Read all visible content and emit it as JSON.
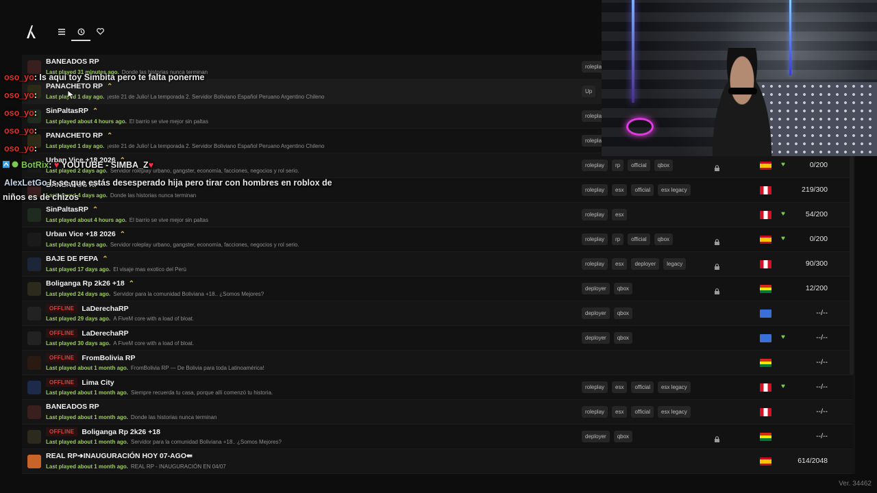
{
  "version": "Ver. 34462",
  "colors": {
    "accent_green": "#9fcf5a",
    "offline_red": "#e0403a",
    "boost_gold": "#e6c04a",
    "fav_green": "#7ec850"
  },
  "nav": {
    "icons": [
      "menu-icon",
      "history-icon",
      "heart-icon"
    ],
    "active": "history"
  },
  "servers": [
    {
      "name": "BANEADOS RP",
      "boost": false,
      "offline": false,
      "last_played": "Last played 31 minutes ago.",
      "desc": "Donde las historias nunca terminan",
      "tags": [
        "roleplay"
      ],
      "locked": false,
      "flag": "",
      "fav": false,
      "players": ""
    },
    {
      "name": "PANACHETO RP",
      "boost": true,
      "offline": false,
      "last_played": "Last played 1 day ago.",
      "desc": "¡este 21 de Julio! La temporada 2. Servidor Boliviano Español Peruano Argentino Chileno",
      "tags": [
        "Up"
      ],
      "locked": false,
      "flag": "",
      "fav": false,
      "players": ""
    },
    {
      "name": "SinPaltasRP",
      "boost": true,
      "offline": false,
      "last_played": "Last played about 4 hours ago.",
      "desc": "El barrio se vive mejor sin paltas",
      "tags": [
        "roleplay"
      ],
      "locked": false,
      "flag": "",
      "fav": false,
      "players": ""
    },
    {
      "name": "PANACHETO RP",
      "boost": true,
      "offline": false,
      "last_played": "Last played 1 day ago.",
      "desc": "¡este 21 de Julio! La temporada 2. Servidor Boliviano Español Peruano Argentino Chileno",
      "tags": [
        "roleplay"
      ],
      "locked": false,
      "flag": "",
      "fav": false,
      "players": ""
    },
    {
      "name": "Urban Vice +18 2026",
      "boost": true,
      "offline": false,
      "last_played": "Last played 2 days ago.",
      "desc": "Servidor roleplay urbano, gangster, economía, facciones, negocios y rol serio.",
      "tags": [
        "roleplay",
        "rp",
        "official",
        "qbox"
      ],
      "locked": true,
      "flag": "es",
      "fav": true,
      "players": "0/200"
    },
    {
      "name": "BANEADOS RP",
      "boost": false,
      "offline": false,
      "last_played": "Last played 4 days ago.",
      "desc": "Donde las historias nunca terminan",
      "tags": [
        "roleplay",
        "esx",
        "official",
        "esx legacy"
      ],
      "locked": false,
      "flag": "pe",
      "fav": false,
      "players": "219/300"
    },
    {
      "name": "SinPaltasRP",
      "boost": true,
      "offline": false,
      "last_played": "Last played about 4 hours ago.",
      "desc": "El barrio se vive mejor sin paltas",
      "tags": [
        "roleplay",
        "esx"
      ],
      "locked": false,
      "flag": "pe",
      "fav": true,
      "players": "54/200"
    },
    {
      "name": "Urban Vice +18 2026",
      "boost": true,
      "offline": false,
      "last_played": "Last played 2 days ago.",
      "desc": "Servidor roleplay urbano, gangster, economía, facciones, negocios y rol serio.",
      "tags": [
        "roleplay",
        "rp",
        "official",
        "qbox"
      ],
      "locked": true,
      "flag": "es",
      "fav": true,
      "players": "0/200"
    },
    {
      "name": "BAJE DE PEPA",
      "boost": true,
      "offline": false,
      "last_played": "Last played 17 days ago.",
      "desc": "El visaje mas exotico del Perú",
      "tags": [
        "roleplay",
        "esx",
        "deployer",
        "legacy"
      ],
      "locked": true,
      "flag": "pe",
      "fav": false,
      "players": "90/300"
    },
    {
      "name": "Boliganga Rp 2k26 +18",
      "boost": true,
      "offline": false,
      "last_played": "Last played 24 days ago.",
      "desc": "Servidor para la comunidad Boliviana +18.. ¿Somos Mejores?",
      "tags": [
        "deployer",
        "qbox"
      ],
      "locked": true,
      "flag": "bo",
      "fav": false,
      "players": "12/200"
    },
    {
      "name": "LaDerechaRP",
      "boost": false,
      "offline": true,
      "last_played": "Last played 29 days ago.",
      "desc": "A FiveM core with a load of bloat.",
      "tags": [
        "deployer",
        "qbox"
      ],
      "locked": false,
      "flag": "un",
      "fav": false,
      "players": "--/--"
    },
    {
      "name": "LaDerechaRP",
      "boost": false,
      "offline": true,
      "last_played": "Last played 30 days ago.",
      "desc": "A FiveM core with a load of bloat.",
      "tags": [
        "deployer",
        "qbox"
      ],
      "locked": false,
      "flag": "un",
      "fav": true,
      "players": "--/--"
    },
    {
      "name": "FromBolivia RP",
      "boost": false,
      "offline": true,
      "last_played": "Last played about 1 month ago.",
      "desc": "FromBolivia RP — De Bolivia para toda Latinoamérica!",
      "tags": [],
      "locked": false,
      "flag": "bo",
      "fav": false,
      "players": "--/--"
    },
    {
      "name": "Lima City",
      "boost": false,
      "offline": true,
      "last_played": "Last played about 1 month ago.",
      "desc": "Siempre recuerda tu casa, porque allí comenzó tu historia.",
      "tags": [
        "roleplay",
        "esx",
        "official",
        "esx legacy"
      ],
      "locked": false,
      "flag": "pe",
      "fav": true,
      "players": "--/--"
    },
    {
      "name": "BANEADOS RP",
      "boost": false,
      "offline": false,
      "last_played": "Last played about 1 month ago.",
      "desc": "Donde las historias nunca terminan",
      "tags": [
        "roleplay",
        "esx",
        "official",
        "esx legacy"
      ],
      "locked": false,
      "flag": "pe",
      "fav": false,
      "players": "--/--"
    },
    {
      "name": "Boliganga Rp 2k26 +18",
      "boost": false,
      "offline": true,
      "last_played": "Last played about 1 month ago.",
      "desc": "Servidor para la comunidad Boliviana +18.. ¿Somos Mejores?",
      "tags": [
        "deployer",
        "qbox"
      ],
      "locked": true,
      "flag": "bo",
      "fav": false,
      "players": "--/--"
    },
    {
      "name": "REAL RP➔INAUGURACIÓN HOY 07-AGO⇚",
      "boost": false,
      "offline": false,
      "last_played": "Last played about 1 month ago.",
      "desc": "REAL RP - INAUGURACIÓN EN 04/07",
      "tags": [],
      "locked": false,
      "flag": "es",
      "fav": false,
      "players": "614/2048"
    }
  ],
  "offline_label": "OFFLINE",
  "chat": [
    {
      "user": "oso_yo",
      "sep": ":",
      "msg": "Is aquí toy Simbita pero te falta ponerme"
    },
    {
      "user": "oso_yo",
      "sep": ":",
      "msg": ""
    },
    {
      "user": "oso_yo",
      "sep": ":",
      "msg": ""
    },
    {
      "user": "oso_yo",
      "sep": ":",
      "msg": ""
    },
    {
      "user": "oso_yo",
      "sep": ":",
      "msg": ""
    },
    {
      "user": "BotRix",
      "sep": ":",
      "msg": "YOUTUBE - SIMBA_Z"
    },
    {
      "user": "AlexLetGo",
      "sep": "",
      "msg": "Is se que estás desesperado hija pero tirar con hombres en roblox de"
    },
    {
      "user": "",
      "sep": "",
      "msg": "niños es de chizos"
    }
  ]
}
